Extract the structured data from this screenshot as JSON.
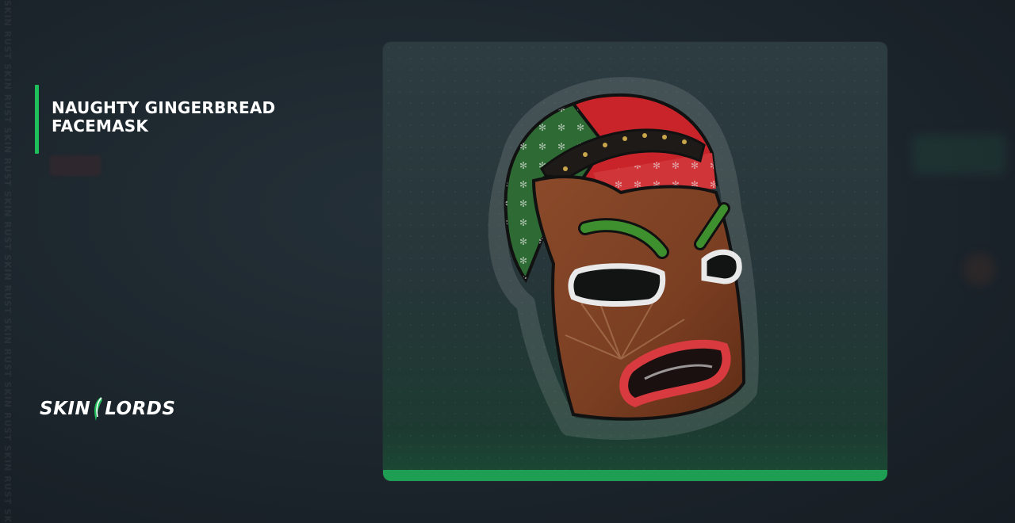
{
  "watermark": "SKIN RUST SKIN RUST SKIN RUST SKIN RUST SKIN RUST SKIN RUST SKIN RUST SKIN RUST SKIN RUST",
  "item": {
    "title_line1": "NAUGHTY GINGERBREAD",
    "title_line2": "FACEMASK"
  },
  "logo": {
    "left": "SKIN",
    "right": "LORDS"
  },
  "colors": {
    "accent": "#1fbf5c",
    "card_bar": "#1d9e53",
    "background": "#1c252c"
  }
}
